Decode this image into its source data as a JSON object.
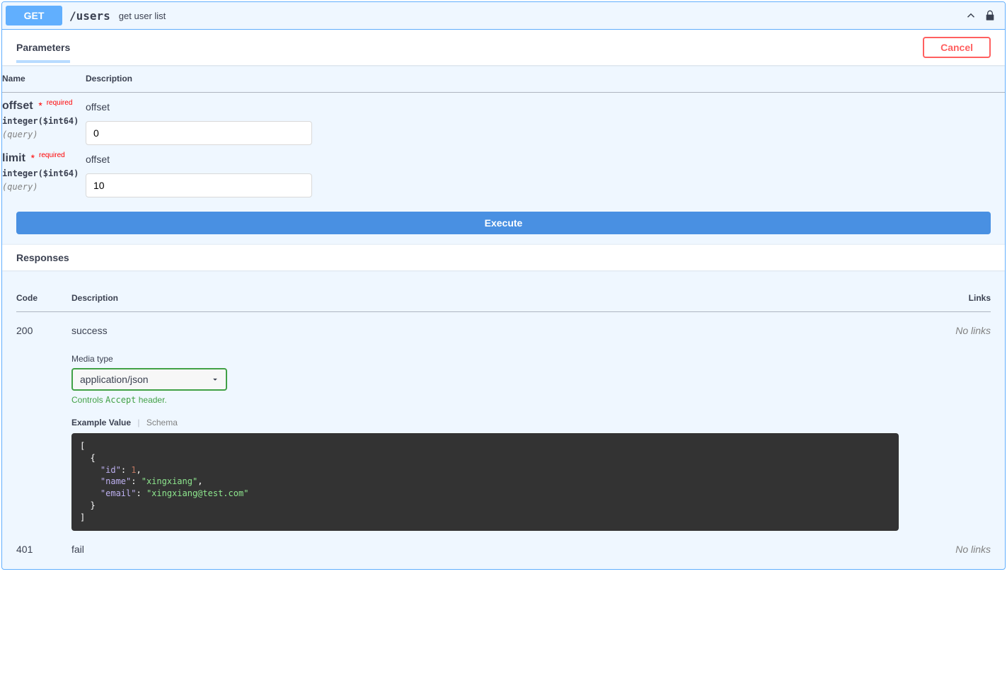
{
  "operation": {
    "method_label": "GET",
    "path": "/users",
    "summary": "get user list"
  },
  "tabs": {
    "parameters_title": "Parameters",
    "cancel_label": "Cancel"
  },
  "param_headers": {
    "name": "Name",
    "description": "Description"
  },
  "parameters": [
    {
      "name": "offset",
      "required_label": "required",
      "type": "integer($int64)",
      "in": "(query)",
      "desc": "offset",
      "value": "0",
      "placeholder": "offset"
    },
    {
      "name": "limit",
      "required_label": "required",
      "type": "integer($int64)",
      "in": "(query)",
      "desc": "offset",
      "value": "10",
      "placeholder": "limit"
    }
  ],
  "execute_label": "Execute",
  "responses_title": "Responses",
  "response_headers": {
    "code": "Code",
    "description": "Description",
    "links": "Links"
  },
  "media": {
    "label": "Media type",
    "selected": "application/json",
    "hint_prefix": "Controls ",
    "hint_code": "Accept",
    "hint_suffix": " header."
  },
  "model_tabs": {
    "active": "Example Value",
    "inactive": "Schema"
  },
  "no_links_label": "No links",
  "responses": [
    {
      "code": "200",
      "desc": "success",
      "example": {
        "open_arr": "[",
        "open_obj": "  {",
        "id_key": "\"id\"",
        "id_val": "1",
        "name_key": "\"name\"",
        "name_val": "\"xingxiang\"",
        "email_key": "\"email\"",
        "email_val": "\"xingxiang@test.com\"",
        "close_obj": "  }",
        "close_arr": "]"
      }
    },
    {
      "code": "401",
      "desc": "fail"
    }
  ]
}
